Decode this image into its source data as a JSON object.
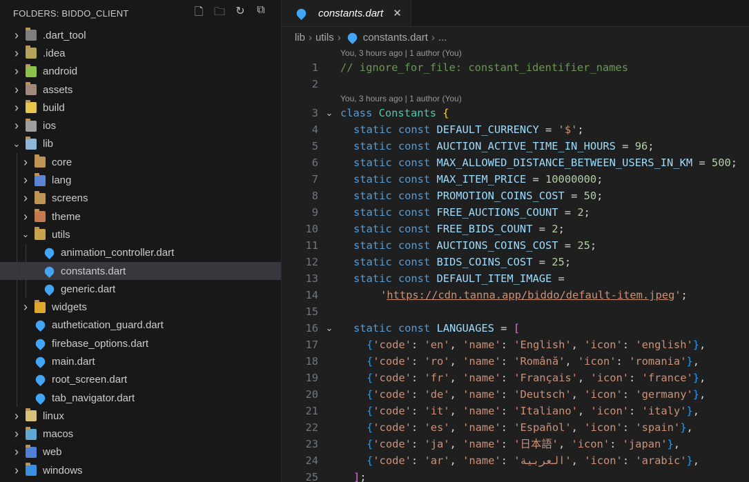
{
  "sidebar": {
    "title": "FOLDERS: BIDDO_CLIENT",
    "actions": [
      "new-file-icon",
      "new-folder-icon",
      "refresh-icon",
      "collapse-all-icon"
    ],
    "items": [
      {
        "label": ".dart_tool",
        "depth": 0,
        "kind": "folder",
        "state": "collapsed",
        "color": "#7f7f7f"
      },
      {
        "label": ".idea",
        "depth": 0,
        "kind": "folder",
        "state": "collapsed",
        "color": "#b4a35b"
      },
      {
        "label": "android",
        "depth": 0,
        "kind": "folder",
        "state": "collapsed",
        "color": "#8bc34a"
      },
      {
        "label": "assets",
        "depth": 0,
        "kind": "folder",
        "state": "collapsed",
        "color": "#a1887f"
      },
      {
        "label": "build",
        "depth": 0,
        "kind": "folder",
        "state": "collapsed",
        "color": "#e6c54d"
      },
      {
        "label": "ios",
        "depth": 0,
        "kind": "folder",
        "state": "collapsed",
        "color": "#9e9e9e"
      },
      {
        "label": "lib",
        "depth": 0,
        "kind": "folder",
        "state": "expanded",
        "color": "#8fb6d9"
      },
      {
        "label": "core",
        "depth": 1,
        "kind": "folder",
        "state": "collapsed",
        "color": "#c09553"
      },
      {
        "label": "lang",
        "depth": 1,
        "kind": "folder",
        "state": "collapsed",
        "color": "#5c85d6"
      },
      {
        "label": "screens",
        "depth": 1,
        "kind": "folder",
        "state": "collapsed",
        "color": "#c09553"
      },
      {
        "label": "theme",
        "depth": 1,
        "kind": "folder",
        "state": "collapsed",
        "color": "#c47a4c"
      },
      {
        "label": "utils",
        "depth": 1,
        "kind": "folder",
        "state": "expanded",
        "color": "#c9a44c"
      },
      {
        "label": "animation_controller.dart",
        "depth": 2,
        "kind": "dart"
      },
      {
        "label": "constants.dart",
        "depth": 2,
        "kind": "dart",
        "selected": true
      },
      {
        "label": "generic.dart",
        "depth": 2,
        "kind": "dart"
      },
      {
        "label": "widgets",
        "depth": 1,
        "kind": "folder",
        "state": "collapsed",
        "color": "#e0a82e"
      },
      {
        "label": "authetication_guard.dart",
        "depth": 1,
        "kind": "dart"
      },
      {
        "label": "firebase_options.dart",
        "depth": 1,
        "kind": "dart"
      },
      {
        "label": "main.dart",
        "depth": 1,
        "kind": "dart"
      },
      {
        "label": "root_screen.dart",
        "depth": 1,
        "kind": "dart"
      },
      {
        "label": "tab_navigator.dart",
        "depth": 1,
        "kind": "dart"
      },
      {
        "label": "linux",
        "depth": 0,
        "kind": "folder",
        "state": "collapsed",
        "color": "#d8c27a"
      },
      {
        "label": "macos",
        "depth": 0,
        "kind": "folder",
        "state": "collapsed",
        "color": "#5fa8d3"
      },
      {
        "label": "web",
        "depth": 0,
        "kind": "folder",
        "state": "collapsed",
        "color": "#4f7fd6"
      },
      {
        "label": "windows",
        "depth": 0,
        "kind": "folder",
        "state": "collapsed",
        "color": "#3b8ee0"
      }
    ]
  },
  "editor": {
    "tab": {
      "label": "constants.dart",
      "close_icon": "close-icon"
    },
    "breadcrumb": [
      "lib",
      "utils",
      "constants.dart",
      "..."
    ],
    "blame": "You, 3 hours ago | 1 author (You)",
    "lines": [
      {
        "n": "1",
        "lens": true,
        "tokens": [
          [
            "c",
            "// ignore_for_file: constant_identifier_names"
          ]
        ]
      },
      {
        "n": "2",
        "tokens": []
      },
      {
        "n": "3",
        "lens": true,
        "fold": true,
        "tokens": [
          [
            "k",
            "class "
          ],
          [
            "cls",
            "Constants"
          ],
          [
            "t",
            " "
          ],
          [
            "b1",
            "{"
          ]
        ]
      },
      {
        "n": "4",
        "indent": 1,
        "tokens": [
          [
            "k",
            "static const "
          ],
          [
            "v",
            "DEFAULT_CURRENCY"
          ],
          [
            "t",
            " = "
          ],
          [
            "s",
            "'$'"
          ],
          [
            "t",
            ";"
          ]
        ]
      },
      {
        "n": "5",
        "indent": 1,
        "tokens": [
          [
            "k",
            "static const "
          ],
          [
            "v",
            "AUCTION_ACTIVE_TIME_IN_HOURS"
          ],
          [
            "t",
            " = "
          ],
          [
            "n",
            "96"
          ],
          [
            "t",
            ";"
          ]
        ]
      },
      {
        "n": "6",
        "indent": 1,
        "tokens": [
          [
            "k",
            "static const "
          ],
          [
            "v",
            "MAX_ALLOWED_DISTANCE_BETWEEN_USERS_IN_KM"
          ],
          [
            "t",
            " = "
          ],
          [
            "n",
            "500"
          ],
          [
            "t",
            ";"
          ]
        ]
      },
      {
        "n": "7",
        "indent": 1,
        "tokens": [
          [
            "k",
            "static const "
          ],
          [
            "v",
            "MAX_ITEM_PRICE"
          ],
          [
            "t",
            " = "
          ],
          [
            "n",
            "10000000"
          ],
          [
            "t",
            ";"
          ]
        ]
      },
      {
        "n": "8",
        "indent": 1,
        "tokens": [
          [
            "k",
            "static const "
          ],
          [
            "v",
            "PROMOTION_COINS_COST"
          ],
          [
            "t",
            " = "
          ],
          [
            "n",
            "50"
          ],
          [
            "t",
            ";"
          ]
        ]
      },
      {
        "n": "9",
        "indent": 1,
        "tokens": [
          [
            "k",
            "static const "
          ],
          [
            "v",
            "FREE_AUCTIONS_COUNT"
          ],
          [
            "t",
            " = "
          ],
          [
            "n",
            "2"
          ],
          [
            "t",
            ";"
          ]
        ]
      },
      {
        "n": "10",
        "indent": 1,
        "tokens": [
          [
            "k",
            "static const "
          ],
          [
            "v",
            "FREE_BIDS_COUNT"
          ],
          [
            "t",
            " = "
          ],
          [
            "n",
            "2"
          ],
          [
            "t",
            ";"
          ]
        ]
      },
      {
        "n": "11",
        "indent": 1,
        "tokens": [
          [
            "k",
            "static const "
          ],
          [
            "v",
            "AUCTIONS_COINS_COST"
          ],
          [
            "t",
            " = "
          ],
          [
            "n",
            "25"
          ],
          [
            "t",
            ";"
          ]
        ]
      },
      {
        "n": "12",
        "indent": 1,
        "tokens": [
          [
            "k",
            "static const "
          ],
          [
            "v",
            "BIDS_COINS_COST"
          ],
          [
            "t",
            " = "
          ],
          [
            "n",
            "25"
          ],
          [
            "t",
            ";"
          ]
        ]
      },
      {
        "n": "13",
        "indent": 1,
        "tokens": [
          [
            "k",
            "static const "
          ],
          [
            "v",
            "DEFAULT_ITEM_IMAGE"
          ],
          [
            "t",
            " ="
          ]
        ]
      },
      {
        "n": "14",
        "indent": 3,
        "tokens": [
          [
            "s",
            "'"
          ],
          [
            "url",
            "https://cdn.tanna.app/biddo/default-item.jpeg"
          ],
          [
            "s",
            "'"
          ],
          [
            "t",
            ";"
          ]
        ]
      },
      {
        "n": "15",
        "tokens": []
      },
      {
        "n": "16",
        "indent": 1,
        "fold": true,
        "tokens": [
          [
            "k",
            "static const "
          ],
          [
            "v",
            "LANGUAGES"
          ],
          [
            "t",
            " = "
          ],
          [
            "b2",
            "["
          ]
        ]
      },
      {
        "n": "17",
        "indent": 2,
        "tokens": [
          [
            "b3",
            "{"
          ],
          [
            "s",
            "'code'"
          ],
          [
            "t",
            ": "
          ],
          [
            "s",
            "'en'"
          ],
          [
            "t",
            ", "
          ],
          [
            "s",
            "'name'"
          ],
          [
            "t",
            ": "
          ],
          [
            "s",
            "'English'"
          ],
          [
            "t",
            ", "
          ],
          [
            "s",
            "'icon'"
          ],
          [
            "t",
            ": "
          ],
          [
            "s",
            "'english'"
          ],
          [
            "b3",
            "}"
          ],
          [
            "t",
            ","
          ]
        ]
      },
      {
        "n": "18",
        "indent": 2,
        "tokens": [
          [
            "b3",
            "{"
          ],
          [
            "s",
            "'code'"
          ],
          [
            "t",
            ": "
          ],
          [
            "s",
            "'ro'"
          ],
          [
            "t",
            ", "
          ],
          [
            "s",
            "'name'"
          ],
          [
            "t",
            ": "
          ],
          [
            "s",
            "'Română'"
          ],
          [
            "t",
            ", "
          ],
          [
            "s",
            "'icon'"
          ],
          [
            "t",
            ": "
          ],
          [
            "s",
            "'romania'"
          ],
          [
            "b3",
            "}"
          ],
          [
            "t",
            ","
          ]
        ]
      },
      {
        "n": "19",
        "indent": 2,
        "tokens": [
          [
            "b3",
            "{"
          ],
          [
            "s",
            "'code'"
          ],
          [
            "t",
            ": "
          ],
          [
            "s",
            "'fr'"
          ],
          [
            "t",
            ", "
          ],
          [
            "s",
            "'name'"
          ],
          [
            "t",
            ": "
          ],
          [
            "s",
            "'Français'"
          ],
          [
            "t",
            ", "
          ],
          [
            "s",
            "'icon'"
          ],
          [
            "t",
            ": "
          ],
          [
            "s",
            "'france'"
          ],
          [
            "b3",
            "}"
          ],
          [
            "t",
            ","
          ]
        ]
      },
      {
        "n": "20",
        "indent": 2,
        "tokens": [
          [
            "b3",
            "{"
          ],
          [
            "s",
            "'code'"
          ],
          [
            "t",
            ": "
          ],
          [
            "s",
            "'de'"
          ],
          [
            "t",
            ", "
          ],
          [
            "s",
            "'name'"
          ],
          [
            "t",
            ": "
          ],
          [
            "s",
            "'Deutsch'"
          ],
          [
            "t",
            ", "
          ],
          [
            "s",
            "'icon'"
          ],
          [
            "t",
            ": "
          ],
          [
            "s",
            "'germany'"
          ],
          [
            "b3",
            "}"
          ],
          [
            "t",
            ","
          ]
        ]
      },
      {
        "n": "21",
        "indent": 2,
        "tokens": [
          [
            "b3",
            "{"
          ],
          [
            "s",
            "'code'"
          ],
          [
            "t",
            ": "
          ],
          [
            "s",
            "'it'"
          ],
          [
            "t",
            ", "
          ],
          [
            "s",
            "'name'"
          ],
          [
            "t",
            ": "
          ],
          [
            "s",
            "'Italiano'"
          ],
          [
            "t",
            ", "
          ],
          [
            "s",
            "'icon'"
          ],
          [
            "t",
            ": "
          ],
          [
            "s",
            "'italy'"
          ],
          [
            "b3",
            "}"
          ],
          [
            "t",
            ","
          ]
        ]
      },
      {
        "n": "22",
        "indent": 2,
        "tokens": [
          [
            "b3",
            "{"
          ],
          [
            "s",
            "'code'"
          ],
          [
            "t",
            ": "
          ],
          [
            "s",
            "'es'"
          ],
          [
            "t",
            ", "
          ],
          [
            "s",
            "'name'"
          ],
          [
            "t",
            ": "
          ],
          [
            "s",
            "'Español'"
          ],
          [
            "t",
            ", "
          ],
          [
            "s",
            "'icon'"
          ],
          [
            "t",
            ": "
          ],
          [
            "s",
            "'spain'"
          ],
          [
            "b3",
            "}"
          ],
          [
            "t",
            ","
          ]
        ]
      },
      {
        "n": "23",
        "indent": 2,
        "tokens": [
          [
            "b3",
            "{"
          ],
          [
            "s",
            "'code'"
          ],
          [
            "t",
            ": "
          ],
          [
            "s",
            "'ja'"
          ],
          [
            "t",
            ", "
          ],
          [
            "s",
            "'name'"
          ],
          [
            "t",
            ": "
          ],
          [
            "s",
            "'日本語'"
          ],
          [
            "t",
            ", "
          ],
          [
            "s",
            "'icon'"
          ],
          [
            "t",
            ": "
          ],
          [
            "s",
            "'japan'"
          ],
          [
            "b3",
            "}"
          ],
          [
            "t",
            ","
          ]
        ]
      },
      {
        "n": "24",
        "indent": 2,
        "tokens": [
          [
            "b3",
            "{"
          ],
          [
            "s",
            "'code'"
          ],
          [
            "t",
            ": "
          ],
          [
            "s",
            "'ar'"
          ],
          [
            "t",
            ", "
          ],
          [
            "s",
            "'name'"
          ],
          [
            "t",
            ": "
          ],
          [
            "s",
            "'العربية'"
          ],
          [
            "t",
            ", "
          ],
          [
            "s",
            "'icon'"
          ],
          [
            "t",
            ": "
          ],
          [
            "s",
            "'arabic'"
          ],
          [
            "b3",
            "}"
          ],
          [
            "t",
            ","
          ]
        ]
      },
      {
        "n": "25",
        "indent": 1,
        "tokens": [
          [
            "b2",
            "]"
          ],
          [
            "t",
            ";"
          ]
        ]
      }
    ]
  }
}
